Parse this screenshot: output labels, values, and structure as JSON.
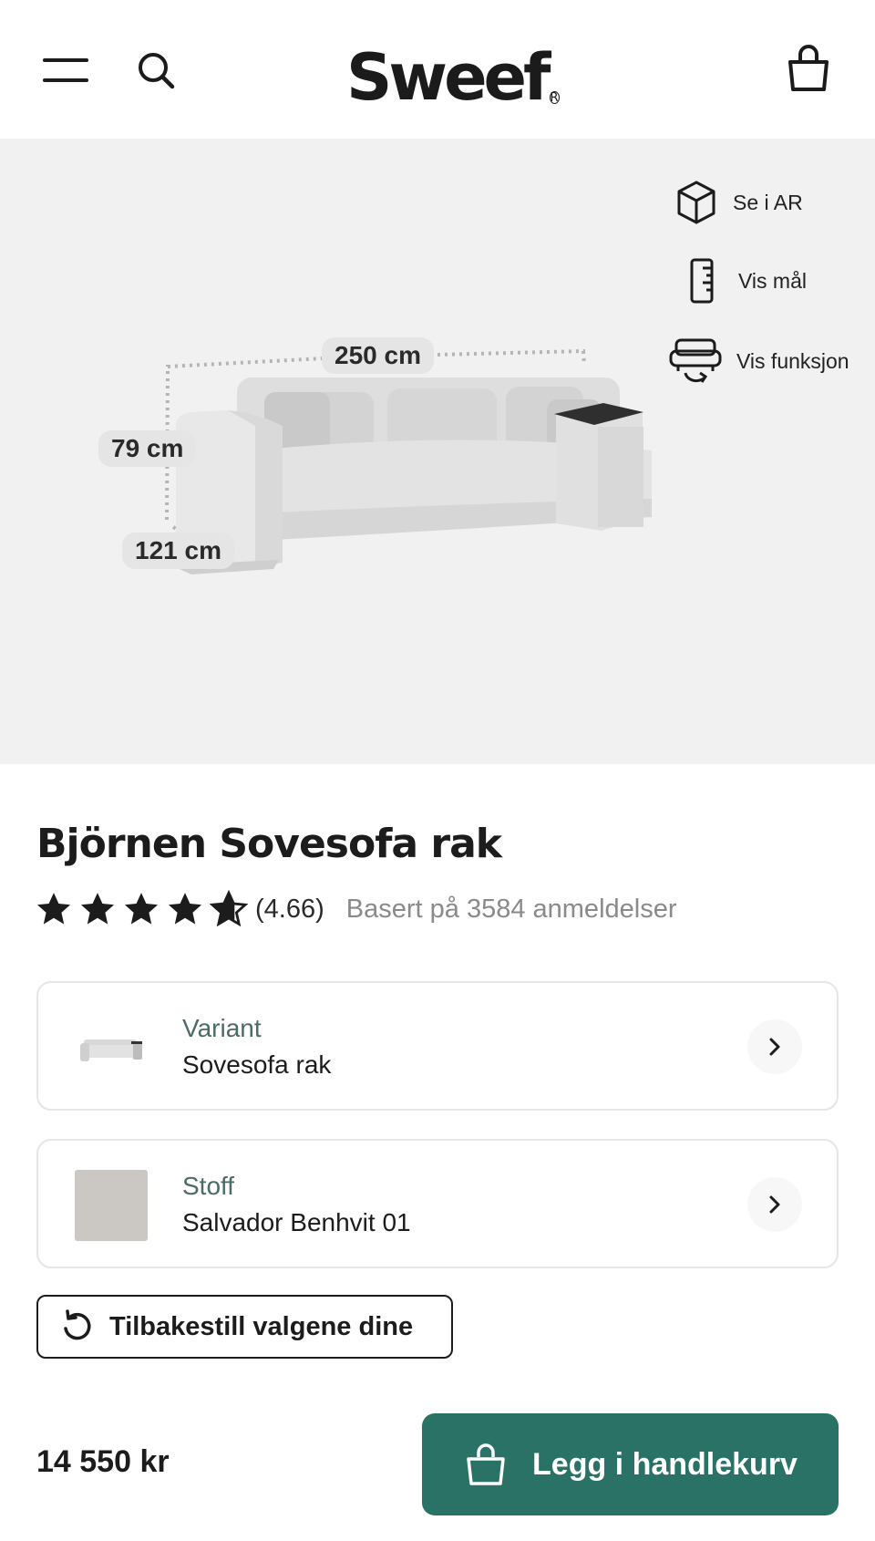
{
  "header": {
    "logo": "Sweef",
    "logo_mark": "R",
    "icons": [
      "hamburger-menu-icon",
      "search-icon",
      "shopping-bag-icon"
    ]
  },
  "hero": {
    "actions": [
      {
        "label": "Se i AR",
        "icon": "cube-icon"
      },
      {
        "label": "Vis mål",
        "icon": "ruler-icon"
      },
      {
        "label": "Vis funksjon",
        "icon": "sofa-rotate-icon"
      }
    ],
    "dimensions": {
      "width": "250 cm",
      "height": "79 cm",
      "depth": "121 cm"
    }
  },
  "product": {
    "title": "Björnen Sovesofa rak",
    "rating_value": "(4.66)",
    "rating_stars": 4.66,
    "review_text": "Basert på 3584 anmeldelser"
  },
  "options": {
    "variant": {
      "label": "Variant",
      "value": "Sovesofa rak"
    },
    "fabric": {
      "label": "Stoff",
      "value": "Salvador Benhvit 01"
    }
  },
  "reset": {
    "label": "Tilbakestill valgene dine"
  },
  "footer": {
    "price": "14 550 kr",
    "add_to_cart": "Legg i handlekurv"
  },
  "colors": {
    "accent": "#2a7266",
    "hero_bg": "#f1f1f1",
    "option_label": "#4a6b68",
    "muted_text": "#8a8a8a"
  }
}
